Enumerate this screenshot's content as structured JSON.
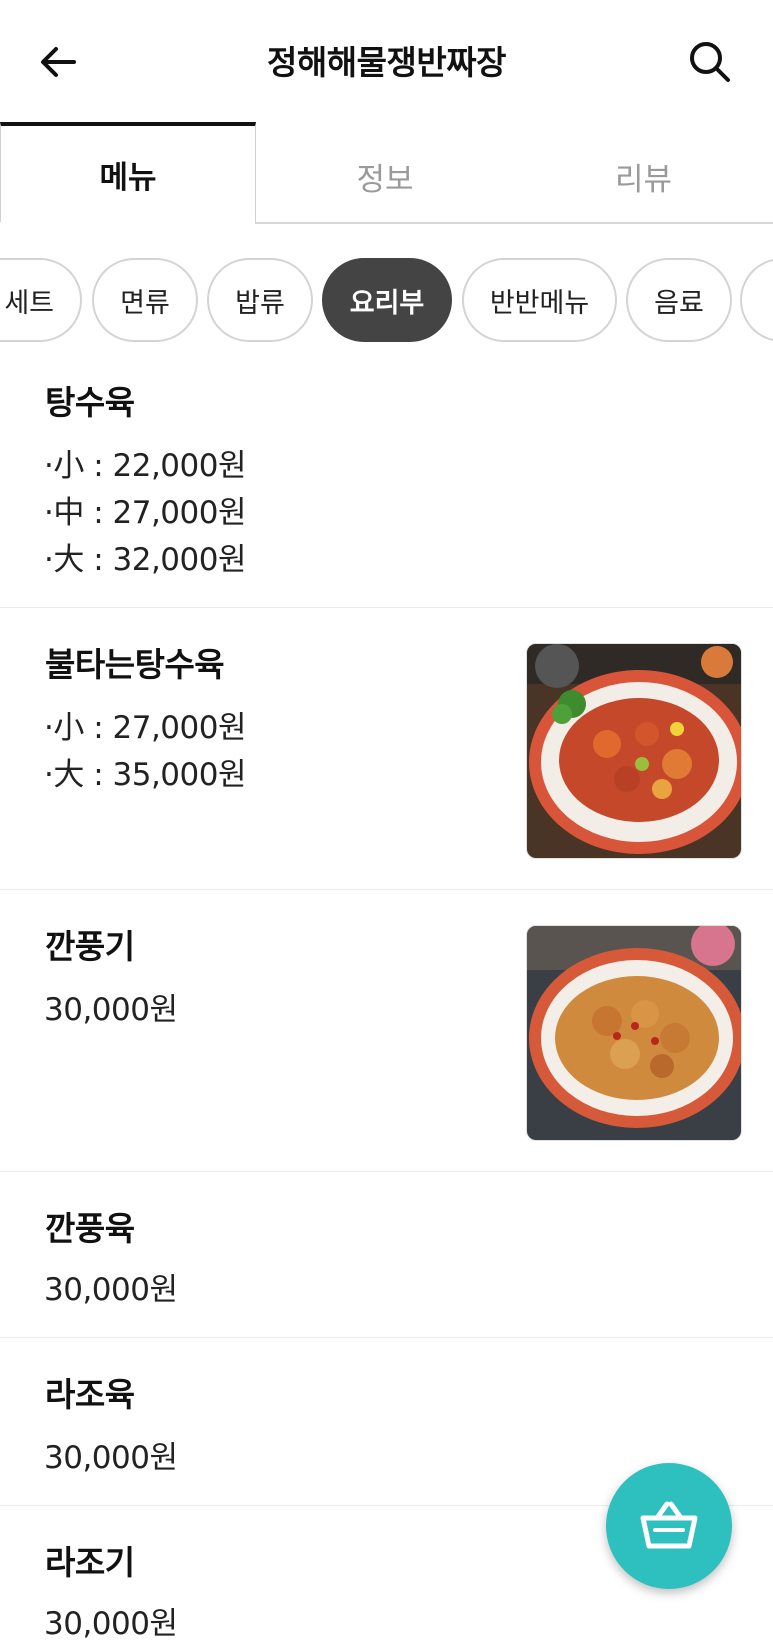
{
  "header": {
    "title": "정해해물쟁반짜장",
    "back_icon": "arrow-left-icon",
    "search_icon": "search-icon"
  },
  "tabs": [
    {
      "label": "메뉴",
      "active": true
    },
    {
      "label": "정보",
      "active": false
    },
    {
      "label": "리뷰",
      "active": false
    }
  ],
  "categories": [
    {
      "label": "세트",
      "active": false
    },
    {
      "label": "면류",
      "active": false
    },
    {
      "label": "밥류",
      "active": false
    },
    {
      "label": "요리부",
      "active": true
    },
    {
      "label": "반반메뉴",
      "active": false
    },
    {
      "label": "음료",
      "active": false
    },
    {
      "label": "",
      "active": false
    }
  ],
  "menu_items": [
    {
      "name": "탕수육",
      "prices": [
        "·小 : 22,000원",
        "·中 : 27,000원",
        "·大 : 32,000원"
      ],
      "has_image": false
    },
    {
      "name": "불타는탕수육",
      "prices": [
        "·小 : 27,000원",
        "·大 : 35,000원"
      ],
      "has_image": true,
      "image": "sweet-and-sour-pork-dish"
    },
    {
      "name": "깐풍기",
      "prices": [
        "30,000원"
      ],
      "has_image": true,
      "image": "kkanpunggi-fried-chicken-dish"
    },
    {
      "name": "깐풍육",
      "prices": [
        "30,000원"
      ],
      "has_image": false
    },
    {
      "name": "라조육",
      "prices": [
        "30,000원"
      ],
      "has_image": false
    },
    {
      "name": "라조기",
      "prices": [
        "30,000원"
      ],
      "has_image": false
    }
  ],
  "cart_button": {
    "icon": "basket-icon",
    "color": "#2ebfbf"
  },
  "colors": {
    "active_chip": "#444444",
    "accent": "#2ebfbf",
    "inactive_tab_text": "#9a9a9a"
  }
}
